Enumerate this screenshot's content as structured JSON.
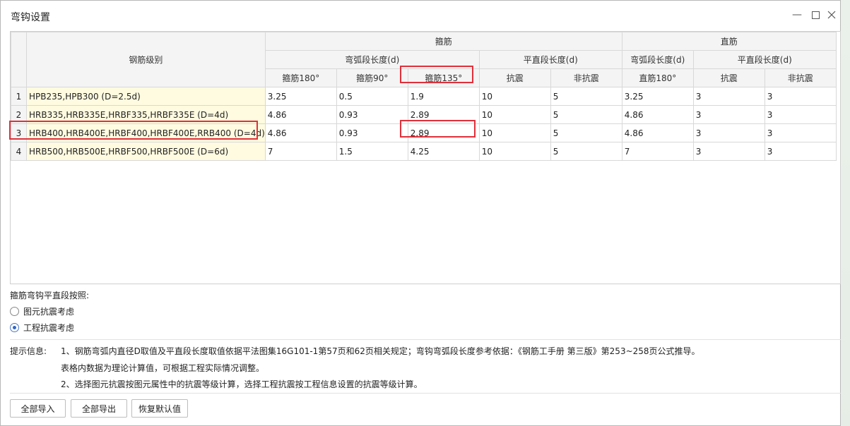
{
  "window": {
    "title": "弯钩设置"
  },
  "table": {
    "header": {
      "grade": "钢筋级别",
      "stirrup": "箍筋",
      "straight_bar": "直筋",
      "arc_length": "弯弧段长度(d)",
      "flat_length": "平直段长度(d)",
      "straight_arc_length": "弯弧段长度(d)",
      "straight_flat_length": "平直段长度(d)",
      "cols": [
        "箍筋180°",
        "箍筋90°",
        "箍筋135°",
        "抗震",
        "非抗震",
        "直筋180°",
        "抗震",
        "非抗震"
      ]
    },
    "rows": [
      {
        "num": "1",
        "grade": "HPB235,HPB300 (D=2.5d)",
        "values": [
          "3.25",
          "0.5",
          "1.9",
          "10",
          "5",
          "3.25",
          "3",
          "3"
        ]
      },
      {
        "num": "2",
        "grade": "HRB335,HRB335E,HRBF335,HRBF335E (D=4d)",
        "values": [
          "4.86",
          "0.93",
          "2.89",
          "10",
          "5",
          "4.86",
          "3",
          "3"
        ]
      },
      {
        "num": "3",
        "grade": "HRB400,HRB400E,HRBF400,HRBF400E,RRB400 (D=4d)",
        "values": [
          "4.86",
          "0.93",
          "2.89",
          "10",
          "5",
          "4.86",
          "3",
          "3"
        ]
      },
      {
        "num": "4",
        "grade": "HRB500,HRB500E,HRBF500,HRBF500E (D=6d)",
        "values": [
          "7",
          "1.5",
          "4.25",
          "10",
          "5",
          "7",
          "3",
          "3"
        ]
      }
    ]
  },
  "flat_basis": {
    "label": "箍筋弯钩平直段按照:",
    "options": [
      {
        "label": "图元抗震考虑",
        "checked": false
      },
      {
        "label": "工程抗震考虑",
        "checked": true
      }
    ]
  },
  "tips": {
    "label": "提示信息:",
    "lines": [
      "1、钢筋弯弧内直径D取值及平直段长度取值依据平法图集16G101-1第57页和62页相关规定；弯钩弯弧段长度参考依据：《钢筋工手册  第三版》第253~258页公式推导。",
      "表格内数据为理论计算值，可根据工程实际情况调整。",
      "2、选择图元抗震按图元属性中的抗震等级计算，选择工程抗震按工程信息设置的抗震等级计算。"
    ]
  },
  "buttons": {
    "import_all": "全部导入",
    "export_all": "全部导出",
    "restore_default": "恢复默认值"
  },
  "colors": {
    "highlight": "#e0303a",
    "grade_cell_bg": "#fffbe0",
    "radio_accent": "#3266c4"
  }
}
